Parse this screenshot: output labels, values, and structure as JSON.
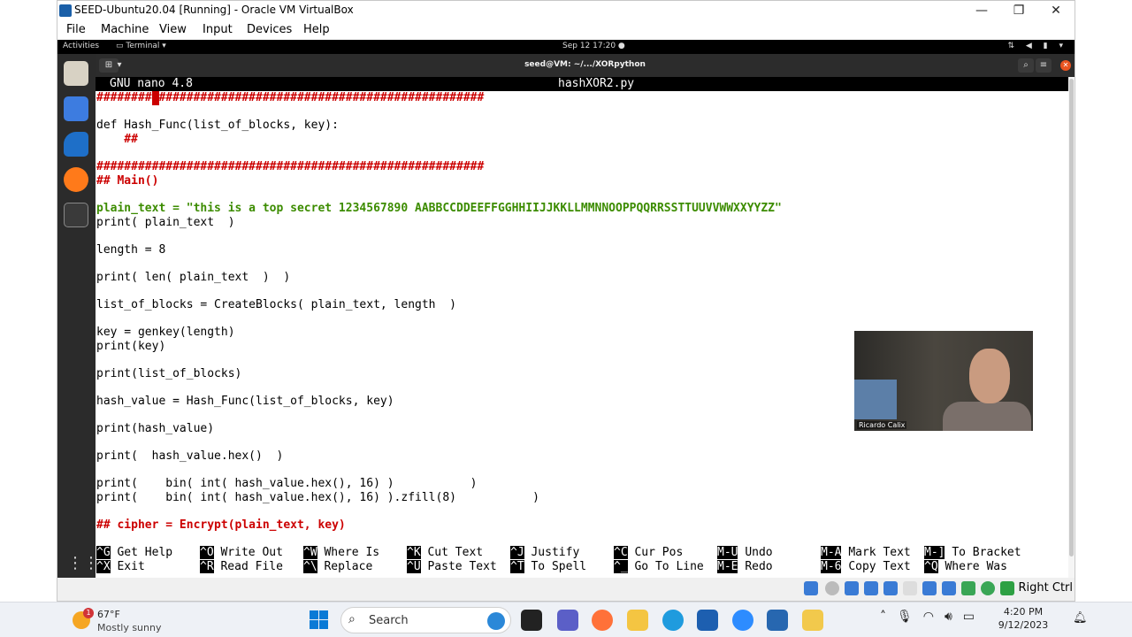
{
  "vbox": {
    "title": "SEED-Ubuntu20.04 [Running] - Oracle VM VirtualBox",
    "menu": [
      "File",
      "Machine",
      "View",
      "Input",
      "Devices",
      "Help"
    ],
    "host_key": "Right Ctrl"
  },
  "gnome": {
    "activities": "Activities",
    "app_menu": "Terminal ▾",
    "clock": "Sep 12  17:20  ●"
  },
  "terminal": {
    "title": "seed@VM: ~/.../XORpython"
  },
  "nano": {
    "version": "GNU nano 4.8",
    "filename": "hashXOR2.py",
    "lines": [
      "########################################################",
      "",
      "def Hash_Func(list_of_blocks, key):",
      "    ##",
      "",
      "########################################################",
      "## Main()",
      "",
      "plain_text = \"this is a top secret 1234567890 AABBCCDDEEFFGGHHIIJJKKLLMMNNOOPPQQRRSSTTUUVVWWXXYYZZ\"",
      "print( plain_text  )",
      "",
      "length = 8",
      "",
      "print( len( plain_text  )  )",
      "",
      "list_of_blocks = CreateBlocks( plain_text, length  )",
      "",
      "key = genkey(length)",
      "print(key)",
      "",
      "print(list_of_blocks)",
      "",
      "hash_value = Hash_Func(list_of_blocks, key)",
      "",
      "print(hash_value)",
      "",
      "print(  hash_value.hex()  )",
      "",
      "print(    bin( int( hash_value.hex(), 16) )           )",
      "print(    bin( int( hash_value.hex(), 16) ).zfill(8)           )",
      "",
      "## cipher = Encrypt(plain_text, key)"
    ],
    "shortcuts": [
      [
        {
          "key": "^G",
          "label": "Get Help"
        },
        {
          "key": "^X",
          "label": "Exit"
        }
      ],
      [
        {
          "key": "^O",
          "label": "Write Out"
        },
        {
          "key": "^R",
          "label": "Read File"
        }
      ],
      [
        {
          "key": "^W",
          "label": "Where Is"
        },
        {
          "key": "^\\",
          "label": "Replace"
        }
      ],
      [
        {
          "key": "^K",
          "label": "Cut Text"
        },
        {
          "key": "^U",
          "label": "Paste Text"
        }
      ],
      [
        {
          "key": "^J",
          "label": "Justify"
        },
        {
          "key": "^T",
          "label": "To Spell"
        }
      ],
      [
        {
          "key": "^C",
          "label": "Cur Pos"
        },
        {
          "key": "^_",
          "label": "Go To Line"
        }
      ],
      [
        {
          "key": "M-U",
          "label": "Undo"
        },
        {
          "key": "M-E",
          "label": "Redo"
        }
      ],
      [
        {
          "key": "M-A",
          "label": "Mark Text"
        },
        {
          "key": "M-6",
          "label": "Copy Text"
        }
      ],
      [
        {
          "key": "M-]",
          "label": "To Bracket"
        },
        {
          "key": "^Q",
          "label": "Where Was"
        }
      ]
    ]
  },
  "webcam": {
    "name": "Ricardo Calix"
  },
  "taskbar": {
    "weather_badge": "1",
    "temperature": "67°F",
    "condition": "Mostly sunny",
    "search_label": "Search",
    "time": "4:20 PM",
    "date": "9/12/2023"
  },
  "colors": {
    "comment_red": "#cc0000",
    "string_green": "#3c8c00",
    "keyword_teal": "#1a7a9a",
    "ubuntu_orange": "#e95420"
  }
}
